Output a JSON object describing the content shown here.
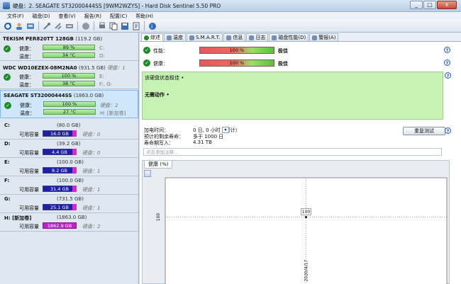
{
  "window": {
    "title": "硬盘：2. SEAGATE ST32000444SS [9WM2WZYS]  -  Hard Disk Sentinel 5.50 PRO",
    "minimize": "_",
    "maximize": "□",
    "close": "x"
  },
  "menu": [
    "文件(F)",
    "磁盘(D)",
    "查看(V)",
    "报告(R)",
    "配置(C)",
    "帮助(H)"
  ],
  "toolbar_icons": [
    "refresh-icon",
    "user-icon",
    "disk-info-icon",
    "wrench-icon",
    "tool-icon",
    "network-icon",
    "globe-icon",
    "stop-icon",
    "print-icon",
    "copy-icon",
    "save-icon",
    "report-icon",
    "help-icon"
  ],
  "disks": [
    {
      "title": "TEKISM PER820TT 128GB",
      "size": "(119.2 GB)",
      "dim": "",
      "health_label": "健康：",
      "health_value": "89 %",
      "health_right": "C:",
      "temp_label": "温度：",
      "temp_value": "34 °C",
      "temp_right": "D:"
    },
    {
      "title": "WDC WD10EZEX-08M2NA0",
      "size": "(931.5 GB)",
      "dim": "硬盘：1",
      "health_label": "健康：",
      "health_value": "100 %",
      "health_right": "E:",
      "temp_label": "温度：",
      "temp_value": "38 °C",
      "temp_right": "F:, G:"
    },
    {
      "title": "SEAGATE ST32000444SS",
      "size": "(1863.0 GB)",
      "dim": "",
      "health_label": "健康：",
      "health_value": "100 %",
      "health_right": "硬盘：2",
      "temp_label": "温度：",
      "temp_value": "27 °C",
      "temp_right": "H: [新加卷]"
    }
  ],
  "volumes": [
    {
      "letter": "C:",
      "size": "(80.0 GB)",
      "label": "可用容量",
      "free": "16.0 GB",
      "disk": "硬盘：0",
      "magenta": false
    },
    {
      "letter": "D:",
      "size": "(39.2 GB)",
      "label": "可用容量",
      "free": "4.4 GB",
      "disk": "硬盘：0",
      "magenta": false
    },
    {
      "letter": "E:",
      "size": "(100.0 GB)",
      "label": "可用容量",
      "free": "8.2 GB",
      "disk": "硬盘：1",
      "magenta": false
    },
    {
      "letter": "F:",
      "size": "(100.0 GB)",
      "label": "可用容量",
      "free": "31.4 GB",
      "disk": "硬盘：1",
      "magenta": false
    },
    {
      "letter": "G:",
      "size": "(731.5 GB)",
      "label": "可用容量",
      "free": "25.1 GB",
      "disk": "硬盘：1",
      "magenta": false
    },
    {
      "letter": "H: [新加卷]",
      "size": "(1863.0 GB)",
      "label": "可用容量",
      "free": "1862.9 GB",
      "disk": "硬盘：2",
      "magenta": true
    }
  ],
  "tabs": [
    {
      "label": "综述",
      "active": true
    },
    {
      "label": "温度",
      "active": false
    },
    {
      "label": "S.M.A.R.T.",
      "active": false
    },
    {
      "label": "信息",
      "active": false
    },
    {
      "label": "日志",
      "active": false
    },
    {
      "label": "磁盘性能(D)",
      "active": false
    },
    {
      "label": "警报(A)",
      "active": false
    }
  ],
  "overview": {
    "performance_label": "性能：",
    "performance_value": "100 %",
    "performance_rating": "极佳",
    "health_label": "健康：",
    "health_value": "100 %",
    "health_rating": "极佳",
    "status_line": "该硬盘状态极佳 •",
    "action_line": "无需动作 •",
    "power_on_label": "加电时间：",
    "power_on_value": "0 日, 0 小时（预计）",
    "lifetime_label": "预计的剩余寿命：",
    "lifetime_value": "多于 1000 日",
    "written_label": "寿命期写入：",
    "written_value": "4.31 TB",
    "retest_button": "重复测试",
    "note_placeholder": "点击添加注释...",
    "help": "?",
    "combo": "▾"
  },
  "chart_data": {
    "type": "line",
    "tab_label": "健康 (%)",
    "x": [
      "2020/4/17"
    ],
    "series": [
      {
        "values": [
          100
        ]
      }
    ],
    "point_label": "100",
    "ylabel": "100",
    "xlabel": "2020/4/17"
  }
}
